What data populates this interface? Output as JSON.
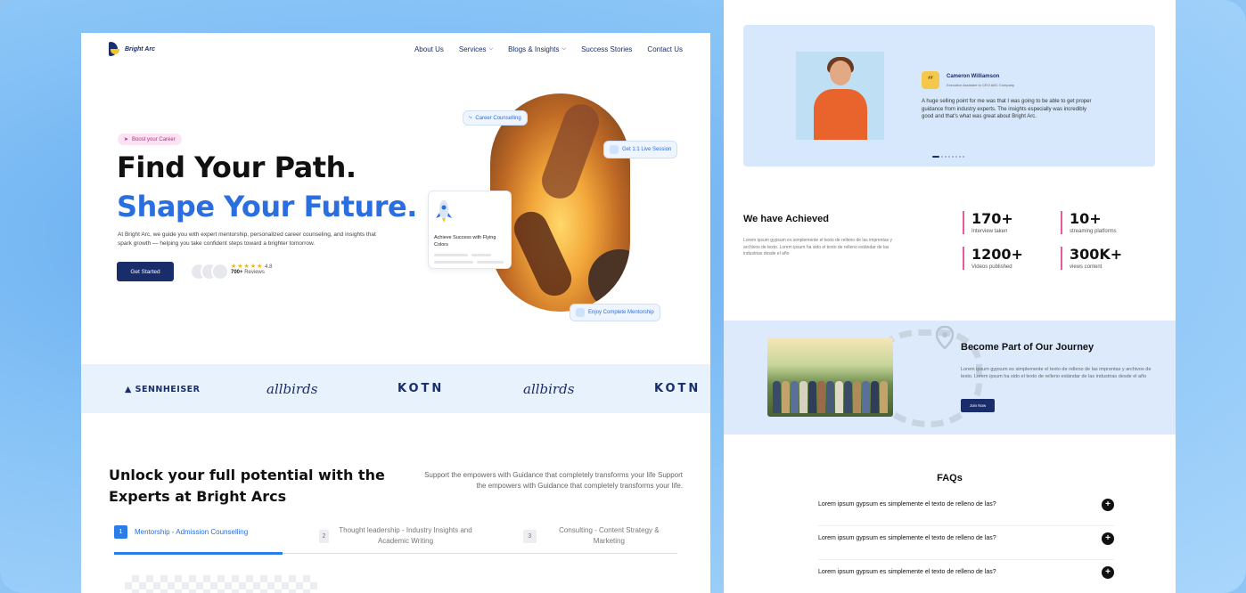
{
  "brand": {
    "name": "Bright Arc"
  },
  "nav": {
    "items": [
      {
        "label": "About Us",
        "dropdown": false
      },
      {
        "label": "Services",
        "dropdown": true
      },
      {
        "label": "Blogs & Insights",
        "dropdown": true
      },
      {
        "label": "Success Stories",
        "dropdown": false
      },
      {
        "label": "Contact Us",
        "dropdown": false
      }
    ]
  },
  "hero": {
    "pill": "Boost your Career",
    "title_line1": "Find Your Path.",
    "title_line2": "Shape Your Future.",
    "lead": "At Bright Arc, we guide you with expert mentorship, personalized career counseling, and insights that spark growth — helping you take confident steps toward a brighter tomorrow.",
    "cta": "Get Started",
    "rating_value": "4.8",
    "reviews": "700+",
    "reviews_label": "Reviews",
    "badge_counselling": "Career Counselling",
    "badge_session": "Get 1:1 Live Session",
    "badge_mentorship": "Enjoy Complete Mentorship",
    "card_achieve": "Achieve Success with Flying Colors"
  },
  "logos": [
    "SENNHEISER",
    "allbirds",
    "KOTN",
    "allbirds",
    "KOTN"
  ],
  "experts": {
    "title": "Unlock your full potential with the Experts at Bright Arcs",
    "description": "Support the empowers with Guidance that completely transforms your life Support the empowers with Guidance that completely transforms your life.",
    "steps": [
      {
        "num": "1",
        "label": "Mentorship - Admission Counselling",
        "active": true
      },
      {
        "num": "2",
        "label": "Thought leadership - Industry Insights and Academic Writing",
        "active": false
      },
      {
        "num": "3",
        "label": "Consulting - Content Strategy & Marketing",
        "active": false
      }
    ]
  },
  "testimonial": {
    "name": "Cameron Williamson",
    "role": "Executive Assistant to CEO ABC Company",
    "quote_mark": "“",
    "text": "A huge selling point for me was that I was going to be able to get proper guidance from industry experts. The insights especially was incredibly good and that's what was great about Bright Arc."
  },
  "achieved": {
    "title": "We have Achieved",
    "description": "Lorem ipsum gypsum es simplemente el texto de relleno de las imprentas y archivos de texto. Lorem ipsum ha sido el texto de relleno estándar de las industrias desde el año",
    "stats": [
      {
        "value": "170+",
        "label": "Interview taken"
      },
      {
        "value": "10+",
        "label": "streaming platforms"
      },
      {
        "value": "1200+",
        "label": "Videos published"
      },
      {
        "value": "300K+",
        "label": "views content"
      }
    ]
  },
  "journey": {
    "title": "Become Part of Our Journey",
    "description": "Lorem ipsum gypsum es simplemente el texto de relleno de las imprentas y archivos de texto. Lorem ipsum ha sido el texto de relleno estándar de las industrias desde el año",
    "cta": "Join Now"
  },
  "faq": {
    "title": "FAQs",
    "items": [
      "Lorem ipsum gypsum es simplemente el texto de relleno de las?",
      "Lorem ipsum gypsum es simplemente el texto de relleno de las?",
      "Lorem ipsum gypsum es simplemente el texto de relleno de las?"
    ]
  },
  "colors": {
    "brand_navy": "#1a2d6b",
    "accent_blue": "#2a6ee0",
    "accent_yellow": "#f3c623",
    "stat_accent": "#e85aa0"
  }
}
